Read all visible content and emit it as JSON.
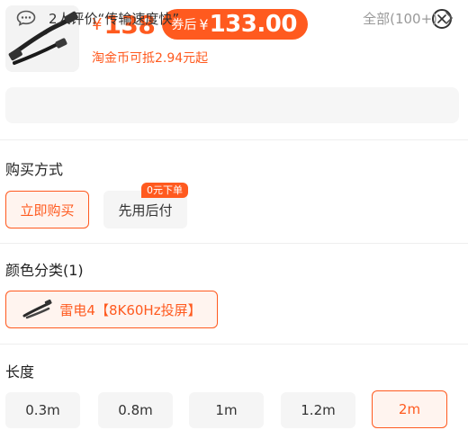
{
  "header": {
    "price_symbol": "¥",
    "price": "138",
    "coupon_label": "券后",
    "coupon_symbol": "¥",
    "coupon_price": "133.00",
    "coin_note": "淘金币可抵2.94元起"
  },
  "review": {
    "text": "2人评价“传输速度快”",
    "all": "全部(100+)"
  },
  "purchase": {
    "title": "购买方式",
    "options": [
      {
        "label": "立即购买",
        "selected": true
      },
      {
        "label": "先用后付",
        "selected": false,
        "badge": "0元下单"
      }
    ]
  },
  "color": {
    "title": "颜色分类(1)",
    "options": [
      {
        "label": "雷电4【8K60Hz投屏】",
        "selected": true,
        "icon": "cable-icon"
      }
    ]
  },
  "length": {
    "title": "长度",
    "options": [
      {
        "label": "0.3m",
        "selected": false
      },
      {
        "label": "0.8m",
        "selected": false
      },
      {
        "label": "1m",
        "selected": false
      },
      {
        "label": "1.2m",
        "selected": false
      },
      {
        "label": "2m",
        "selected": true
      }
    ]
  },
  "colors": {
    "accent": "#ff5a1f",
    "chip_bg": "#f5f5f5"
  }
}
